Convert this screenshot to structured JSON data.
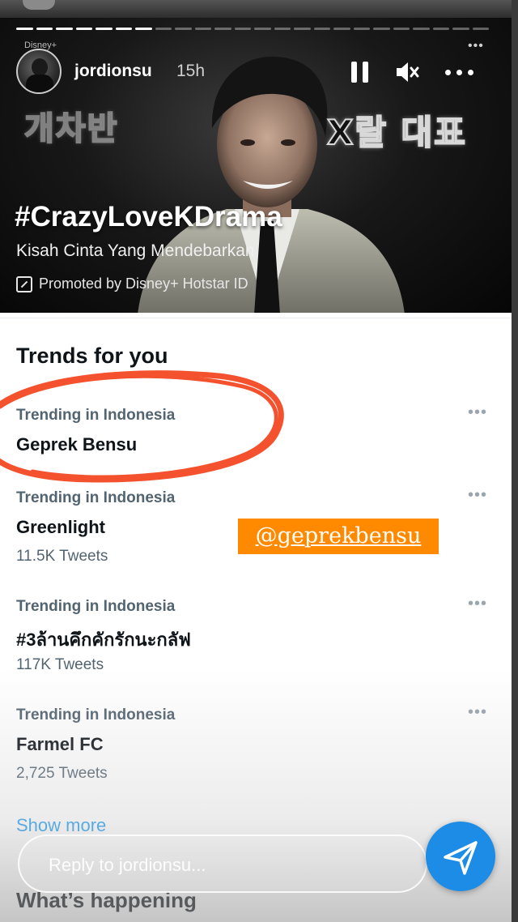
{
  "story": {
    "username": "jordionsu",
    "time_ago": "15h",
    "brand_tag": "Disney+",
    "neon_left": "개차반",
    "neon_right": "X랄 대표",
    "hashtag": "#CrazyLoveKDrama",
    "subtitle": "Kisah Cinta Yang Mendebarkan",
    "promoted": "Promoted by Disney+ Hotstar ID",
    "progress_segments": 24,
    "progress_done": 7
  },
  "panel": {
    "section_title": "Trends for you",
    "trends": [
      {
        "context": "Trending in Indonesia",
        "name": "Geprek Bensu",
        "count": ""
      },
      {
        "context": "Trending in Indonesia",
        "name": "Greenlight",
        "count": "11.5K Tweets"
      },
      {
        "context": "Trending in Indonesia",
        "name": "#3ล้านคึกคักรักนะกลัฟ",
        "count": "117K Tweets"
      },
      {
        "context": "Trending in Indonesia",
        "name": "Farmel FC",
        "count": "2,725 Tweets"
      }
    ],
    "more_glyph": "•••",
    "show_more": "Show more",
    "whats_happening": "What’s happening"
  },
  "sticker": {
    "text": "@geprekbensu",
    "color": "#ff8a00"
  },
  "highlight_color": "#f4522e",
  "reply": {
    "placeholder": "Reply to jordionsu..."
  },
  "colors": {
    "accent": "#1d9bf0",
    "send_button": "#1c8ce6"
  }
}
